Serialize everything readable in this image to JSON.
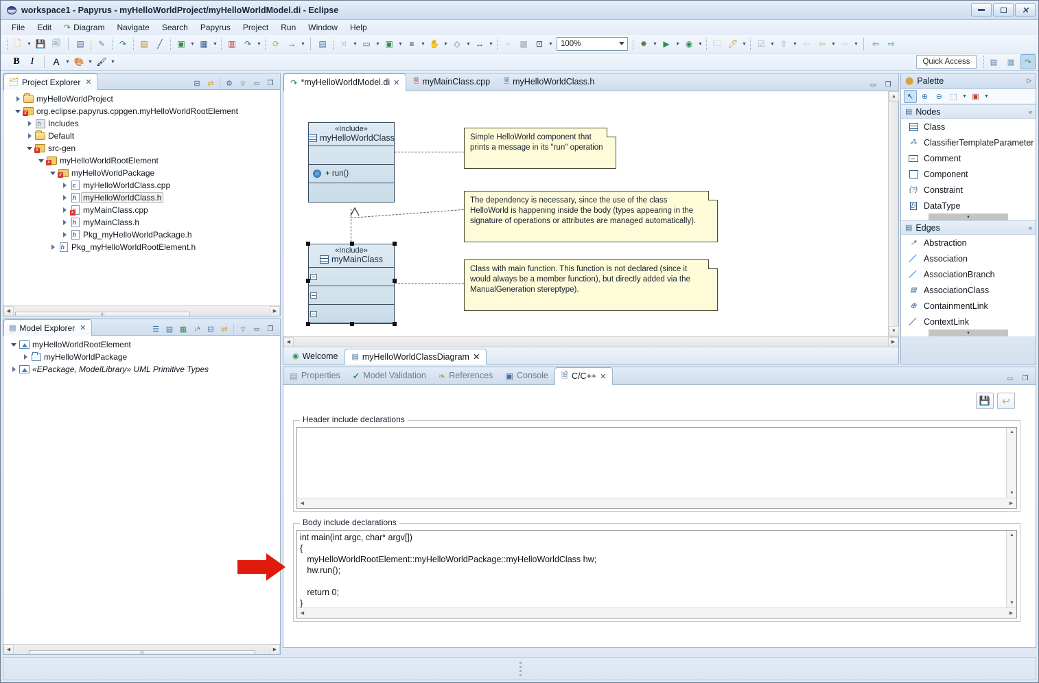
{
  "window": {
    "title": "workspace1 - Papyrus - myHelloWorldProject/myHelloWorldModel.di - Eclipse",
    "icon": "papyrus-globe-icon",
    "minimize": "–",
    "maximize": "□",
    "close": "✕"
  },
  "menu": {
    "items": [
      {
        "label": "File"
      },
      {
        "label": "Edit"
      },
      {
        "label": "Diagram",
        "icon": "papyrus-icon"
      },
      {
        "label": "Navigate"
      },
      {
        "label": "Search"
      },
      {
        "label": "Papyrus"
      },
      {
        "label": "Project"
      },
      {
        "label": "Run"
      },
      {
        "label": "Window"
      },
      {
        "label": "Help"
      }
    ]
  },
  "toolbar": {
    "zoom_level": "100%",
    "quick_access": "Quick Access",
    "items": [
      {
        "name": "new-wizard-icon",
        "glyph": "🗋"
      },
      {
        "name": "save-icon",
        "glyph": "💾"
      },
      {
        "name": "save-all-icon",
        "glyph": "🗐"
      },
      {
        "name": "binary-icon",
        "glyph": "⊞"
      },
      {
        "name": "pencil-icon",
        "glyph": "✎"
      },
      {
        "name": "papyrus-icon",
        "glyph": "↷"
      },
      {
        "name": "outline-icon",
        "glyph": "▤"
      },
      {
        "name": "line-icon",
        "glyph": "╱"
      },
      {
        "name": "new-class-icon",
        "glyph": "▣"
      },
      {
        "name": "new-diagram-icon",
        "glyph": "▦"
      },
      {
        "name": "new-note-icon",
        "glyph": "▥"
      },
      {
        "name": "papyrus-nav-icon",
        "glyph": "↷"
      },
      {
        "name": "refresh-icon",
        "glyph": "⟳"
      },
      {
        "name": "arrow-right-icon",
        "glyph": "→"
      },
      {
        "name": "copy-appearance-icon",
        "glyph": "▤"
      },
      {
        "name": "align-icon",
        "glyph": "⁂"
      },
      {
        "name": "distribute-icon",
        "glyph": "▭"
      },
      {
        "name": "arrange-icon",
        "glyph": "▣"
      },
      {
        "name": "text-align-icon",
        "glyph": "≡"
      },
      {
        "name": "hand-icon",
        "glyph": "✋"
      },
      {
        "name": "resize-icon",
        "glyph": "◇"
      },
      {
        "name": "fit-width-icon",
        "glyph": "↔"
      },
      {
        "name": "snap-icon",
        "glyph": "▫"
      },
      {
        "name": "grid-icon",
        "glyph": "▩"
      },
      {
        "name": "zoom-fit-icon",
        "glyph": "⊡"
      },
      {
        "name": "debug-icon",
        "glyph": "✹"
      },
      {
        "name": "run-icon",
        "glyph": "▶"
      },
      {
        "name": "profile-icon",
        "glyph": "◉"
      },
      {
        "name": "open-type-icon",
        "glyph": "🗀"
      },
      {
        "name": "search-icon",
        "glyph": "🖊"
      },
      {
        "name": "todo-icon",
        "glyph": "☑"
      },
      {
        "name": "next-annotation-icon",
        "glyph": "⇧"
      },
      {
        "name": "prev-edit-icon",
        "glyph": "⇦"
      },
      {
        "name": "back-edit-icon",
        "glyph": "⇦"
      },
      {
        "name": "forward-edit-icon",
        "glyph": "⇨"
      },
      {
        "name": "back-nav-icon",
        "glyph": "⇦"
      },
      {
        "name": "forward-nav-icon",
        "glyph": "⇨"
      }
    ],
    "format": [
      {
        "name": "bold-button",
        "glyph": "B"
      },
      {
        "name": "italic-button",
        "glyph": "I"
      },
      {
        "name": "font-color-button",
        "glyph": "A"
      },
      {
        "name": "fill-color-button",
        "glyph": "🎨"
      },
      {
        "name": "line-color-button",
        "glyph": "🖌"
      }
    ],
    "perspective": [
      {
        "name": "open-perspective-button",
        "glyph": "▤"
      },
      {
        "name": "modeling-perspective-button",
        "glyph": "M"
      },
      {
        "name": "papyrus-perspective-button",
        "glyph": "↷",
        "active": true
      }
    ]
  },
  "project_explorer": {
    "title": "Project Explorer",
    "close_glyph": "✕",
    "tools": [
      {
        "name": "collapse-all-icon",
        "glyph": "⊟"
      },
      {
        "name": "link-with-editor-icon",
        "glyph": "⇆"
      },
      {
        "name": "view-menu-filter-icon",
        "glyph": "⚙"
      },
      {
        "name": "view-menu-icon",
        "glyph": "▽"
      },
      {
        "name": "minimize-icon",
        "glyph": "▭"
      },
      {
        "name": "maximize-icon",
        "glyph": "❐"
      }
    ],
    "tree": [
      {
        "label": "myHelloWorldProject",
        "indent": 0,
        "twisty": "collapsed",
        "icon": "folder-open-icon",
        "selected": false
      },
      {
        "label": "org.eclipse.papyrus.cppgen.myHelloWorldRootElement",
        "indent": 0,
        "twisty": "expanded",
        "icon": "cproject-error-icon",
        "selected": false
      },
      {
        "label": "Includes",
        "indent": 1,
        "twisty": "collapsed",
        "icon": "includes-icon",
        "selected": false
      },
      {
        "label": "Default",
        "indent": 1,
        "twisty": "collapsed",
        "icon": "folder-open-icon",
        "selected": false
      },
      {
        "label": "src-gen",
        "indent": 1,
        "twisty": "expanded",
        "icon": "source-folder-error-icon",
        "selected": false
      },
      {
        "label": "myHelloWorldRootElement",
        "indent": 2,
        "twisty": "expanded",
        "icon": "package-error-icon",
        "selected": false
      },
      {
        "label": "myHelloWorldPackage",
        "indent": 3,
        "twisty": "expanded",
        "icon": "package-error-icon",
        "selected": false
      },
      {
        "label": "myHelloWorldClass.cpp",
        "indent": 4,
        "twisty": "collapsed",
        "icon": "cpp-file-icon",
        "selected": false
      },
      {
        "label": "myHelloWorldClass.h",
        "indent": 4,
        "twisty": "collapsed",
        "icon": "header-file-icon",
        "selected": true
      },
      {
        "label": "myMainClass.cpp",
        "indent": 4,
        "twisty": "collapsed",
        "icon": "cpp-file-error-icon",
        "selected": false
      },
      {
        "label": "myMainClass.h",
        "indent": 4,
        "twisty": "collapsed",
        "icon": "header-file-icon",
        "selected": false
      },
      {
        "label": "Pkg_myHelloWorldPackage.h",
        "indent": 4,
        "twisty": "collapsed",
        "icon": "header-file-icon",
        "selected": false
      },
      {
        "label": "Pkg_myHelloWorldRootElement.h",
        "indent": 3,
        "twisty": "collapsed",
        "icon": "header-file-icon",
        "selected": false
      }
    ]
  },
  "model_explorer": {
    "title": "Model Explorer",
    "close_glyph": "✕",
    "tools": [
      {
        "name": "list-view-icon",
        "glyph": "☰"
      },
      {
        "name": "tree-view-icon",
        "glyph": "▤"
      },
      {
        "name": "validate-icon",
        "glyph": "▦"
      },
      {
        "name": "sort-alpha-icon",
        "glyph": "↓ᴬ"
      },
      {
        "name": "collapse-all-icon",
        "glyph": "⊟"
      },
      {
        "name": "link-with-editor-icon",
        "glyph": "⇆"
      },
      {
        "name": "view-menu-icon",
        "glyph": "▽"
      },
      {
        "name": "minimize-icon",
        "glyph": "▭"
      },
      {
        "name": "maximize-icon",
        "glyph": "❐"
      }
    ],
    "tree": [
      {
        "label": "myHelloWorldRootElement",
        "indent": 0,
        "twisty": "expanded",
        "icon": "uml-model-icon",
        "italic": false
      },
      {
        "label": "myHelloWorldPackage",
        "indent": 1,
        "twisty": "collapsed",
        "icon": "uml-package-icon",
        "italic": false
      },
      {
        "label": "«EPackage, ModelLibrary» UML Primitive Types",
        "indent": 0,
        "twisty": "collapsed",
        "icon": "uml-profile-icon",
        "italic": true
      }
    ]
  },
  "editor": {
    "tabs": [
      {
        "label": "*myHelloWorldModel.di",
        "icon": "papyrus-icon",
        "active": true,
        "closable": true
      },
      {
        "label": "myMainClass.cpp",
        "icon": "cpp-file-error-icon",
        "active": false,
        "closable": false
      },
      {
        "label": "myHelloWorldClass.h",
        "icon": "header-file-icon",
        "active": false,
        "closable": false
      }
    ],
    "tools": [
      {
        "name": "minimize-icon",
        "glyph": "▭"
      },
      {
        "name": "maximize-icon",
        "glyph": "❐"
      }
    ],
    "sub_tabs": [
      {
        "label": "Welcome",
        "icon": "welcome-icon",
        "active": false,
        "closable": false
      },
      {
        "label": "myHelloWorldClassDiagram",
        "icon": "class-diagram-icon",
        "active": true,
        "closable": true
      }
    ]
  },
  "diagram": {
    "classes": [
      {
        "name": "myHelloWorldClass",
        "stereotype": "«Include»",
        "selected": false,
        "compartments": [
          {
            "type": "attributes",
            "members": []
          },
          {
            "type": "operations",
            "members": [
              {
                "label": "+ run()",
                "icon": "operation-icon"
              }
            ]
          },
          {
            "type": "other",
            "members": []
          }
        ]
      },
      {
        "name": "myMainClass",
        "stereotype": "«Include»",
        "selected": true,
        "compartments": [
          {
            "type": "attributes",
            "members": []
          },
          {
            "type": "operations",
            "members": []
          },
          {
            "type": "other",
            "members": []
          }
        ]
      }
    ],
    "notes": [
      {
        "id": "note1",
        "text": "Simple HelloWorld component that\nprints a message in its \"run\" operation"
      },
      {
        "id": "note2",
        "text": "The dependency is necessary, since the use of the class\nHelloWorld is happening inside the body (types appearing in the\nsignature of operations or attributes are managed automatically)."
      },
      {
        "id": "note3",
        "text": "Class with main function. This function is not declared (since it\nwould always be a member function), but directly added via the\nManualGeneration stereptype)."
      }
    ],
    "relationship": "generalization-dashed-arrow"
  },
  "palette": {
    "title": "Palette",
    "expand_glyph": "▷",
    "tools": [
      {
        "name": "select-tool",
        "glyph": "↖",
        "active": true
      },
      {
        "name": "zoom-in-tool",
        "glyph": "⊕"
      },
      {
        "name": "zoom-out-tool",
        "glyph": "⊖"
      },
      {
        "name": "marquee-tool",
        "glyph": "⬚"
      },
      {
        "name": "marquee-dropdown",
        "glyph": "▾"
      },
      {
        "name": "format-tool",
        "glyph": "▣"
      },
      {
        "name": "format-dropdown",
        "glyph": "▾"
      }
    ],
    "groups": [
      {
        "label": "Nodes",
        "collapse_glyph": "«",
        "items": [
          {
            "label": "Class",
            "icon": "class-shape-icon"
          },
          {
            "label": "ClassifierTemplateParameter",
            "icon": "template-parameter-icon"
          },
          {
            "label": "Comment",
            "icon": "comment-shape-icon"
          },
          {
            "label": "Component",
            "icon": "component-shape-icon"
          },
          {
            "label": "Constraint",
            "icon": "constraint-icon"
          },
          {
            "label": "DataType",
            "icon": "datatype-icon"
          }
        ],
        "more_glyph": "▾"
      },
      {
        "label": "Edges",
        "collapse_glyph": "«",
        "items": [
          {
            "label": "Abstraction",
            "icon": "abstraction-edge-icon"
          },
          {
            "label": "Association",
            "icon": "association-edge-icon"
          },
          {
            "label": "AssociationBranch",
            "icon": "association-branch-edge-icon"
          },
          {
            "label": "AssociationClass",
            "icon": "association-class-edge-icon"
          },
          {
            "label": "ContainmentLink",
            "icon": "containment-link-icon"
          },
          {
            "label": "ContextLink",
            "icon": "context-link-icon"
          }
        ],
        "more_glyph": "▾"
      }
    ]
  },
  "bottom_panel": {
    "tabs": [
      {
        "label": "Properties",
        "icon": "properties-icon",
        "active": false,
        "closable": false
      },
      {
        "label": "Model Validation",
        "icon": "validation-check-icon",
        "active": false,
        "closable": false
      },
      {
        "label": "References",
        "icon": "references-icon",
        "active": false,
        "closable": false
      },
      {
        "label": "Console",
        "icon": "console-icon",
        "active": false,
        "closable": false
      },
      {
        "label": "C/C++",
        "icon": "cpp-icon",
        "active": true,
        "closable": true
      }
    ],
    "tools": [
      {
        "name": "minimize-icon",
        "glyph": "▭"
      },
      {
        "name": "maximize-icon",
        "glyph": "❐"
      }
    ],
    "actions": [
      {
        "name": "save-button",
        "glyph": "💾"
      },
      {
        "name": "revert-button",
        "glyph": "↩"
      }
    ],
    "header_section": {
      "legend": "Header include declarations",
      "value": "",
      "placeholder": ""
    },
    "body_section": {
      "legend": "Body include declarations",
      "value": "int main(int argc, char* argv[])\n{\n   myHelloWorldRootElement::myHelloWorldPackage::myHelloWorldClass hw;\n   hw.run();\n\n   return 0;\n}",
      "placeholder": ""
    }
  },
  "annotation": {
    "red_arrow": "red-pointer-arrow"
  },
  "colors": {
    "accent": "#3b7cb5",
    "note_bg": "#fdfbd8",
    "class_bg": "#c9dde9",
    "arrow_red": "#e01b0c",
    "chrome": "#dde7f3"
  }
}
